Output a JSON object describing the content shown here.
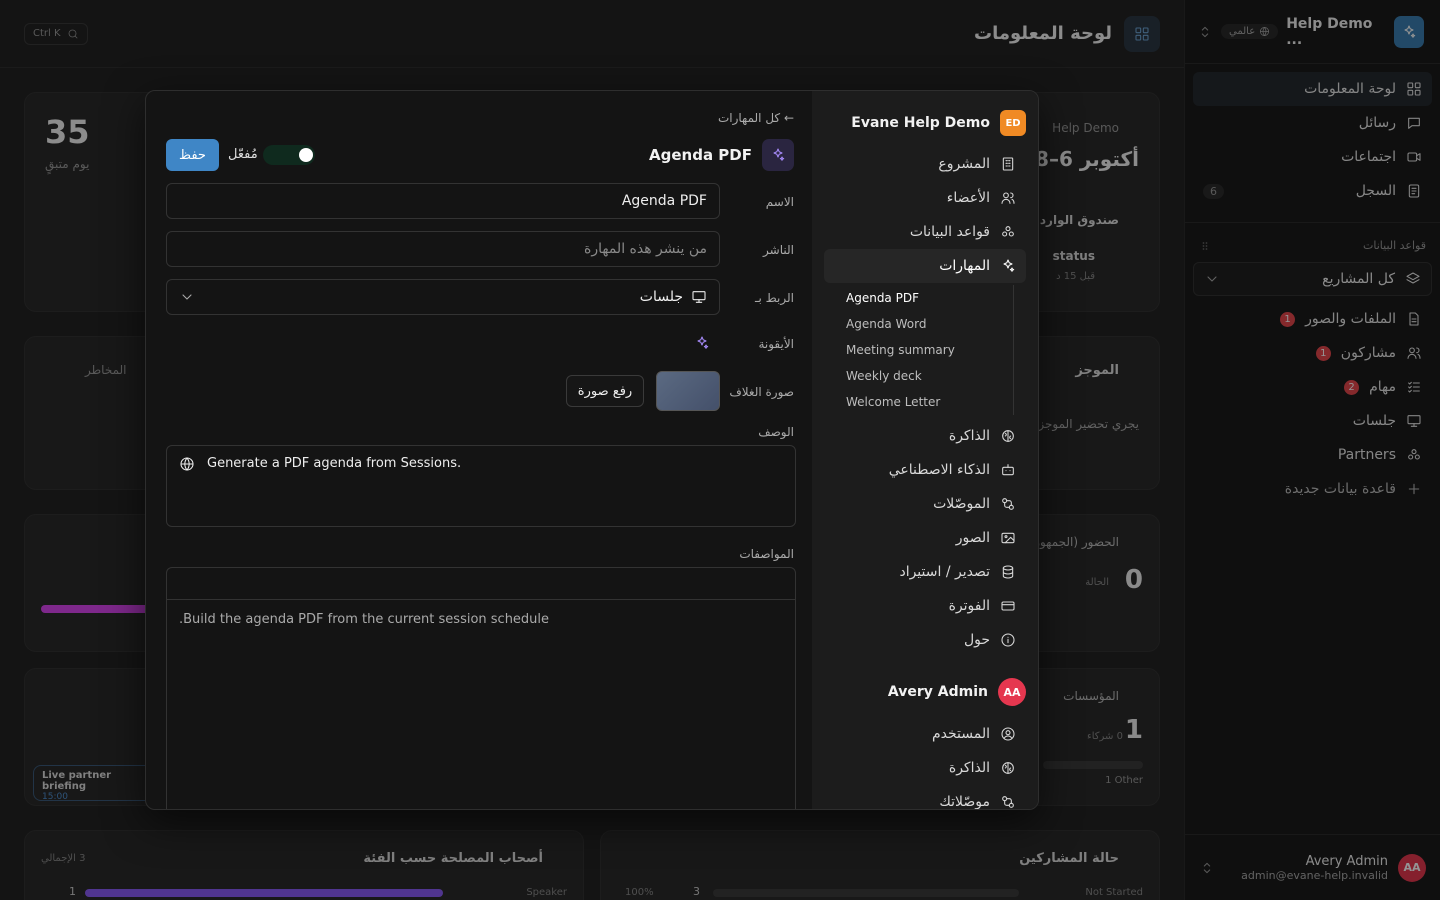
{
  "sidebar": {
    "title": "Help Demo ...",
    "scope": "عالمي",
    "nav": [
      {
        "label": "لوحة المعلومات",
        "icon": "dashboard-icon"
      },
      {
        "label": "رسائل",
        "icon": "message-icon"
      },
      {
        "label": "اجتماعات",
        "icon": "video-icon"
      },
      {
        "label": "السجل",
        "icon": "log-icon",
        "count": "6"
      }
    ],
    "databases_label": "قواعد البيانات",
    "project_select": "كل المشاريع",
    "databases": [
      {
        "label": "الملفات والصور",
        "badge": "1"
      },
      {
        "label": "مشاركون",
        "badge": "1"
      },
      {
        "label": "مهام",
        "badge": "2"
      },
      {
        "label": "جلسات",
        "badge": ""
      },
      {
        "label": "Partners",
        "badge": ""
      }
    ],
    "new_database": "قاعدة بيانات جديدة",
    "user": {
      "name": "Avery Admin",
      "email": "admin@evane-help.invalid",
      "initials": "AA"
    }
  },
  "dashboard": {
    "title": "لوحة المعلومات",
    "shortcut": "Ctrl K",
    "kpi_value": "35",
    "kpi_label": "يوم متبقٍ",
    "date_card_org": "Help Demo",
    "date_card_value": "أكتوبر 6–8",
    "inbox_label": "صندوق الوارد",
    "status_label": "status",
    "status_time": "قبل 15 د",
    "risks_label": "المخاطر",
    "brief_label": "الموجز",
    "brief_text": "يجري تحضير الموجز",
    "attendance_label": "الحضور (الجمهور)",
    "attendance_value": "0",
    "attendance_sub": "الحالة",
    "orgs_label": "المؤسسات",
    "orgs_value": "1",
    "orgs_sub": "0 شركاء",
    "orgs_other": "1 Other",
    "live_title": "Live partner briefing",
    "live_time": "15:00",
    "stakeholders_label": "أصحاب المصلحة حسب الفئة",
    "stakeholders_total": "3 الإجمالي",
    "stakeholders_row": {
      "label": "Speaker",
      "value": "1"
    },
    "participants_label": "حالة المشاركين",
    "participants_row": {
      "label": "Not Started",
      "value": "3",
      "pct": "100%"
    }
  },
  "modal": {
    "org_name": "Evane Help Demo",
    "org_initials": "ED",
    "nav": [
      {
        "label": "المشروع",
        "icon": "building-icon"
      },
      {
        "label": "الأعضاء",
        "icon": "members-icon"
      },
      {
        "label": "قواعد البيانات",
        "icon": "database-icon"
      },
      {
        "label": "المهارات",
        "icon": "sparkles-icon",
        "active": true
      }
    ],
    "skills": [
      "Agenda PDF",
      "Agenda Word",
      "Meeting summary",
      "Weekly deck",
      "Welcome Letter"
    ],
    "nav2": [
      {
        "label": "الذاكرة",
        "icon": "brain-icon"
      },
      {
        "label": "الذكاء الاصطناعي",
        "icon": "bot-icon"
      },
      {
        "label": "الموصّلات",
        "icon": "connector-icon"
      },
      {
        "label": "الصور",
        "icon": "images-icon"
      },
      {
        "label": "تصدير / استيراد",
        "icon": "export-icon"
      },
      {
        "label": "الفوترة",
        "icon": "billing-icon"
      },
      {
        "label": "حول",
        "icon": "info-icon"
      }
    ],
    "user_name": "Avery Admin",
    "user_initials": "AA",
    "user_nav": [
      {
        "label": "المستخدم",
        "icon": "user-circle-icon"
      },
      {
        "label": "الذاكرة",
        "icon": "brain-icon"
      },
      {
        "label": "موصّلاتك",
        "icon": "connector-icon"
      }
    ],
    "back_link": "← كل المهارات",
    "skill_title": "Agenda PDF",
    "toggle_label": "مُفعّل",
    "save_label": "حفظ",
    "fields": {
      "name_label": "الاسم",
      "name_value": "Agenda PDF",
      "publisher_label": "الناشر",
      "publisher_placeholder": "من ينشر هذه المهارة",
      "link_label": "الربط بـ",
      "link_value": "جلسات",
      "icon_label": "الأيقونة",
      "cover_label": "صورة الغلاف",
      "upload_label": "رفع صورة",
      "description_label": "الوصف",
      "description_value": "Generate a PDF agenda from Sessions.",
      "spec_label": "المواصفات",
      "spec_placeholder": "Build the agenda PDF from the current session schedule."
    }
  },
  "colors": {
    "accent": "#3f86c6",
    "badge": "#e5484d",
    "avatar": "#e5374f",
    "org": "#f08a24",
    "skill": "#a78bfa"
  }
}
